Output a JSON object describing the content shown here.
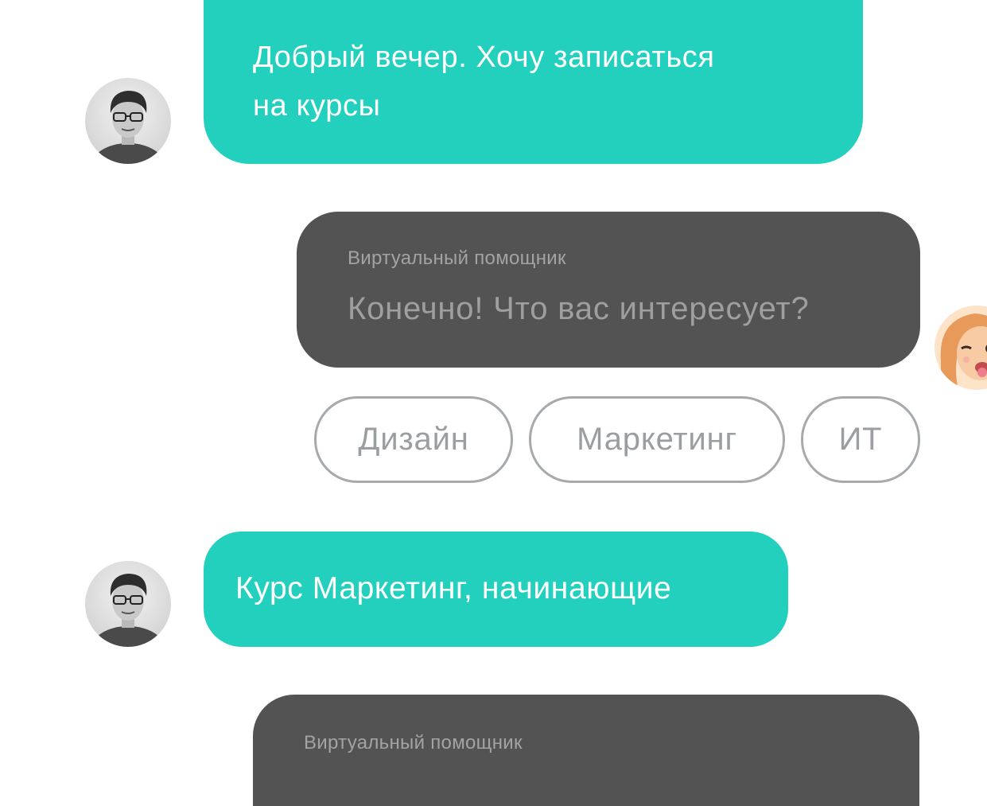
{
  "chat": {
    "messages": [
      {
        "role": "user",
        "text": "Добрый вечер. Хочу записаться\nна курсы"
      },
      {
        "role": "assistant",
        "sender": "Виртуальный помощник",
        "text": "Конечно! Что вас интересует?"
      },
      {
        "role": "user",
        "text": "Курс Маркетинг, начинающие"
      },
      {
        "role": "assistant",
        "sender": "Виртуальный помощник",
        "text": ""
      }
    ],
    "options": [
      "Дизайн",
      "Маркетинг",
      "ИТ"
    ],
    "colors": {
      "user_bubble": "#23d0bd",
      "assistant_bubble": "#535353",
      "chip_border": "#a7aaad",
      "chip_text": "#9b9ea1"
    },
    "avatars": {
      "user": "user-photo-avatar",
      "assistant": "memoji-avatar"
    }
  }
}
